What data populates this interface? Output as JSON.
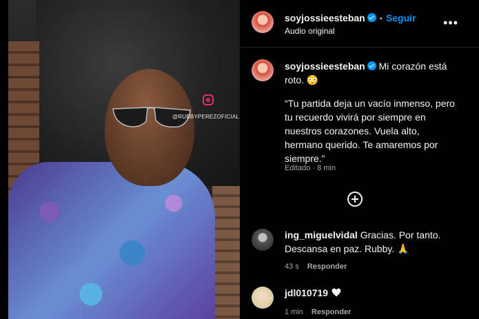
{
  "media": {
    "watermark": "@RUBBYPEREZOFICIAL",
    "icon": "instagram-icon"
  },
  "header": {
    "username": "soyjossieesteban",
    "follow_label": "Seguir",
    "separator": "•",
    "audio_label": "Audio original",
    "more_label": "•••"
  },
  "caption": {
    "username": "soyjossieesteban",
    "first_line": "Mi corazón está roto. 😳",
    "quote": "“Tu partida deja un vacío inmenso, pero tu recuerdo vivirá por siempre en nuestros corazones. Vuela alto, hermano querido. Te amaremos por siempre.”",
    "meta": "Editado · 8 min"
  },
  "comments": [
    {
      "username": "ing_miguelvidal",
      "text": "Gracias. Por tanto. Descansa en paz. Rubby. 🙏",
      "time": "43 s",
      "reply_label": "Responder"
    },
    {
      "username": "jdl010719",
      "text": "",
      "time": "1 min",
      "reply_label": "Responder"
    }
  ],
  "colors": {
    "accent": "#0095f6",
    "background": "#000000",
    "muted": "#a8a8a8",
    "instagram": "#e1306c"
  }
}
